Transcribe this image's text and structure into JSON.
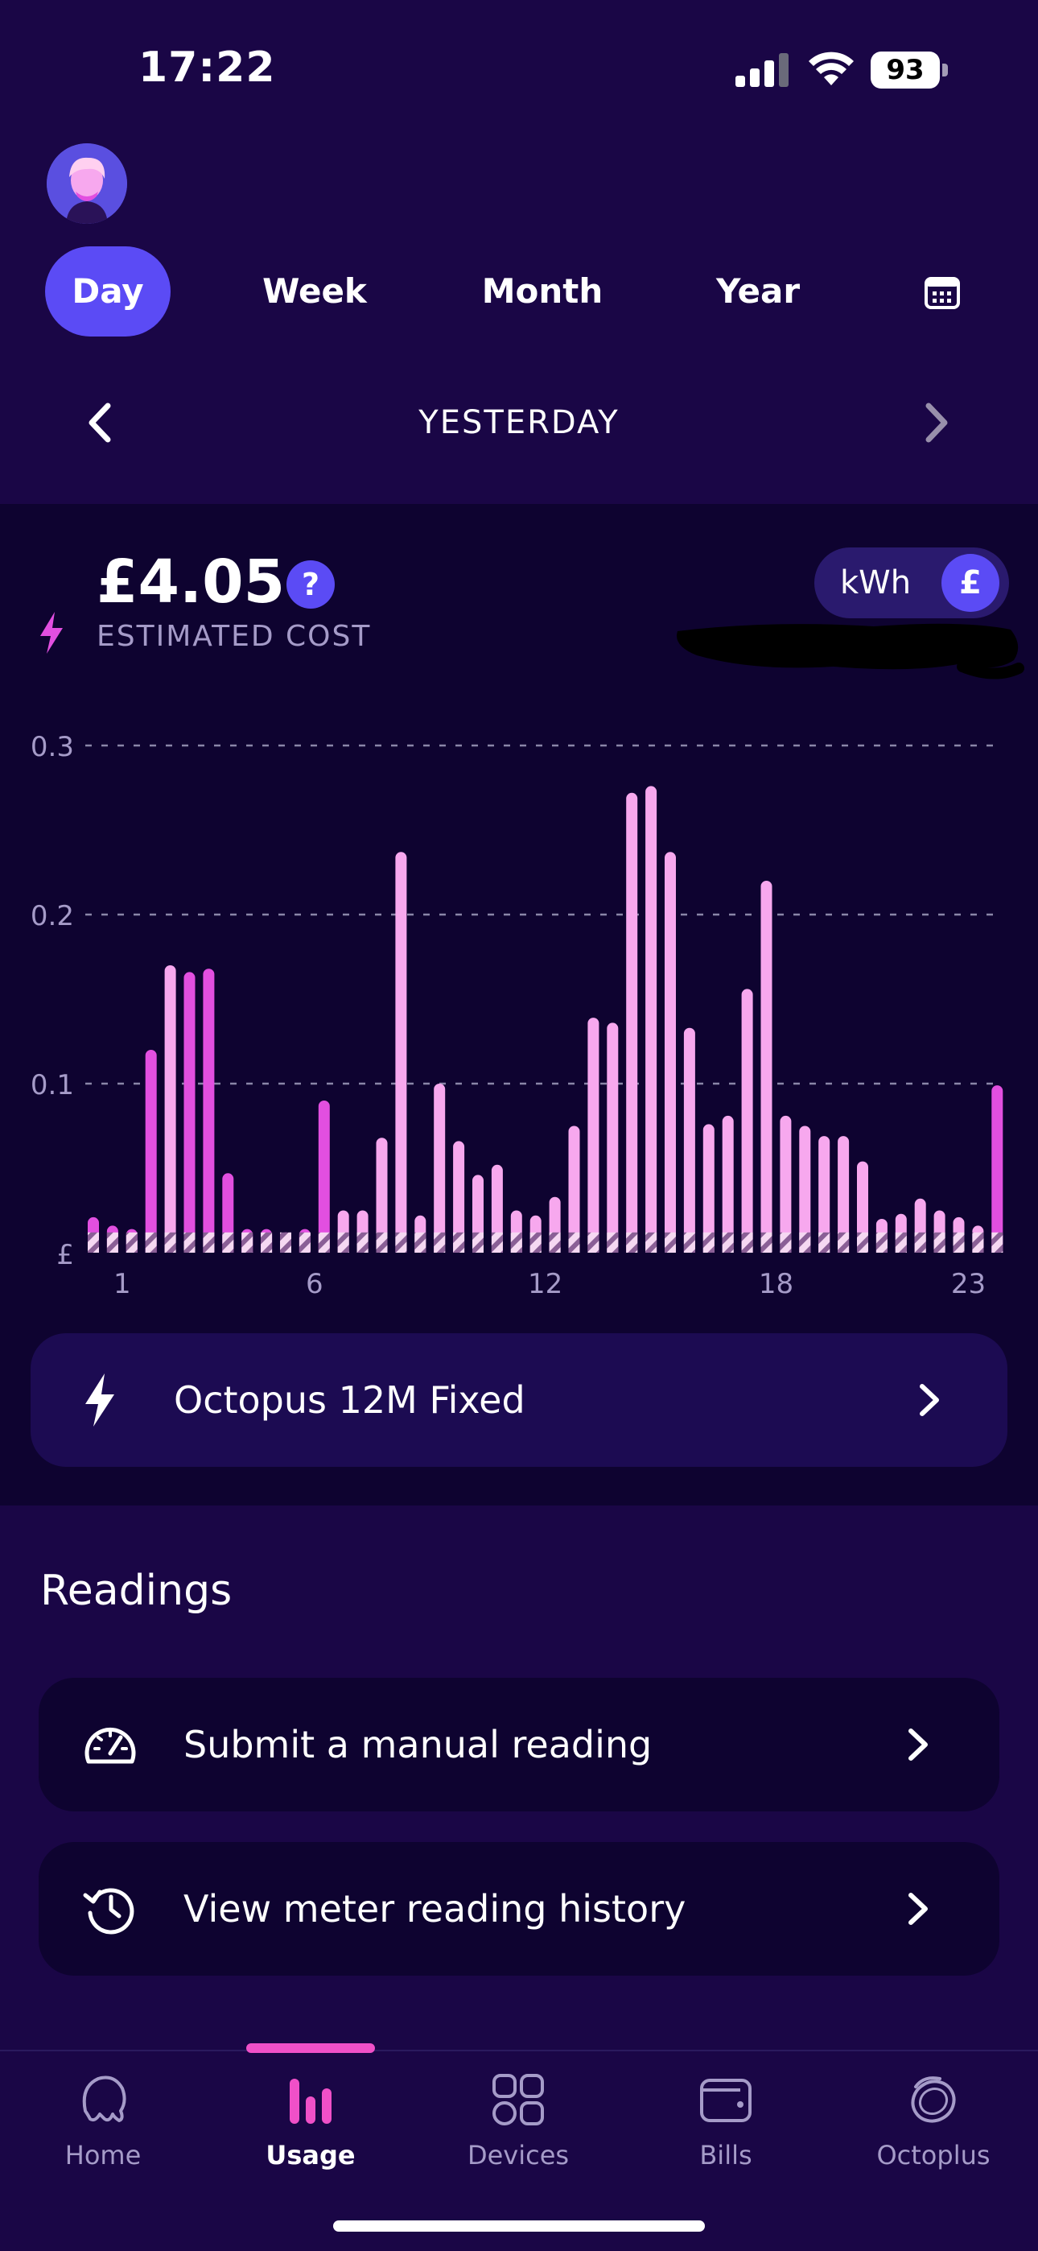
{
  "status_bar": {
    "time": "17:22",
    "battery": "93"
  },
  "period_tabs": [
    "Day",
    "Week",
    "Month",
    "Year"
  ],
  "active_tab": "Day",
  "date_nav": {
    "label": "YESTERDAY"
  },
  "summary": {
    "cost": "£4.05",
    "help": "?",
    "label": "ESTIMATED COST",
    "unit_kwh": "kWh",
    "unit_gbp": "£"
  },
  "chart_data": {
    "type": "bar",
    "y_label": "£",
    "ylim": [
      0,
      0.3
    ],
    "y_ticks": [
      "0.3",
      "0.2",
      "0.1"
    ],
    "x_tick_labels": [
      "1",
      "6",
      "12",
      "18",
      "23"
    ],
    "x_tick_hours": [
      1,
      6,
      12,
      18,
      23
    ],
    "standing_charge_hatched": 0.012,
    "grid": true,
    "bar_colors": {
      "low": "#e24fe0",
      "high": "#f7a8ee"
    },
    "values": [
      0.021,
      0.016,
      0.014,
      0.12,
      0.17,
      0.166,
      0.168,
      0.047,
      0.014,
      0.014,
      0.012,
      0.014,
      0.09,
      0.025,
      0.025,
      0.068,
      0.237,
      0.022,
      0.1,
      0.066,
      0.046,
      0.052,
      0.025,
      0.022,
      0.033,
      0.075,
      0.139,
      0.136,
      0.272,
      0.276,
      0.237,
      0.133,
      0.076,
      0.081,
      0.156,
      0.22,
      0.081,
      0.075,
      0.069,
      0.069,
      0.054,
      0.02,
      0.023,
      0.032,
      0.025,
      0.021,
      0.016,
      0.099
    ],
    "value_colors": [
      "low",
      "low",
      "low",
      "low",
      "high",
      "low",
      "low",
      "low",
      "low",
      "low",
      "low",
      "low",
      "low",
      "high",
      "high",
      "high",
      "high",
      "high",
      "high",
      "high",
      "high",
      "high",
      "high",
      "high",
      "high",
      "high",
      "high",
      "high",
      "high",
      "high",
      "high",
      "high",
      "high",
      "high",
      "high",
      "high",
      "high",
      "high",
      "high",
      "high",
      "high",
      "high",
      "high",
      "high",
      "high",
      "high",
      "high",
      "low"
    ]
  },
  "tariff": {
    "name": "Octopus 12M Fixed"
  },
  "readings": {
    "title": "Readings",
    "items": [
      {
        "label": "Submit a manual reading",
        "icon": "gauge-icon"
      },
      {
        "label": "View meter reading history",
        "icon": "history-icon"
      }
    ]
  },
  "bottom_nav": [
    {
      "label": "Home",
      "icon": "octopus-icon"
    },
    {
      "label": "Usage",
      "icon": "bar-chart-icon"
    },
    {
      "label": "Devices",
      "icon": "devices-grid-icon"
    },
    {
      "label": "Bills",
      "icon": "wallet-icon"
    },
    {
      "label": "Octoplus",
      "icon": "coin-icon"
    }
  ],
  "active_nav": "Usage",
  "colors": {
    "background": "#1a0646",
    "panel": "#0e0330",
    "accent": "#5b4bf5",
    "pink": "#f050c8"
  }
}
